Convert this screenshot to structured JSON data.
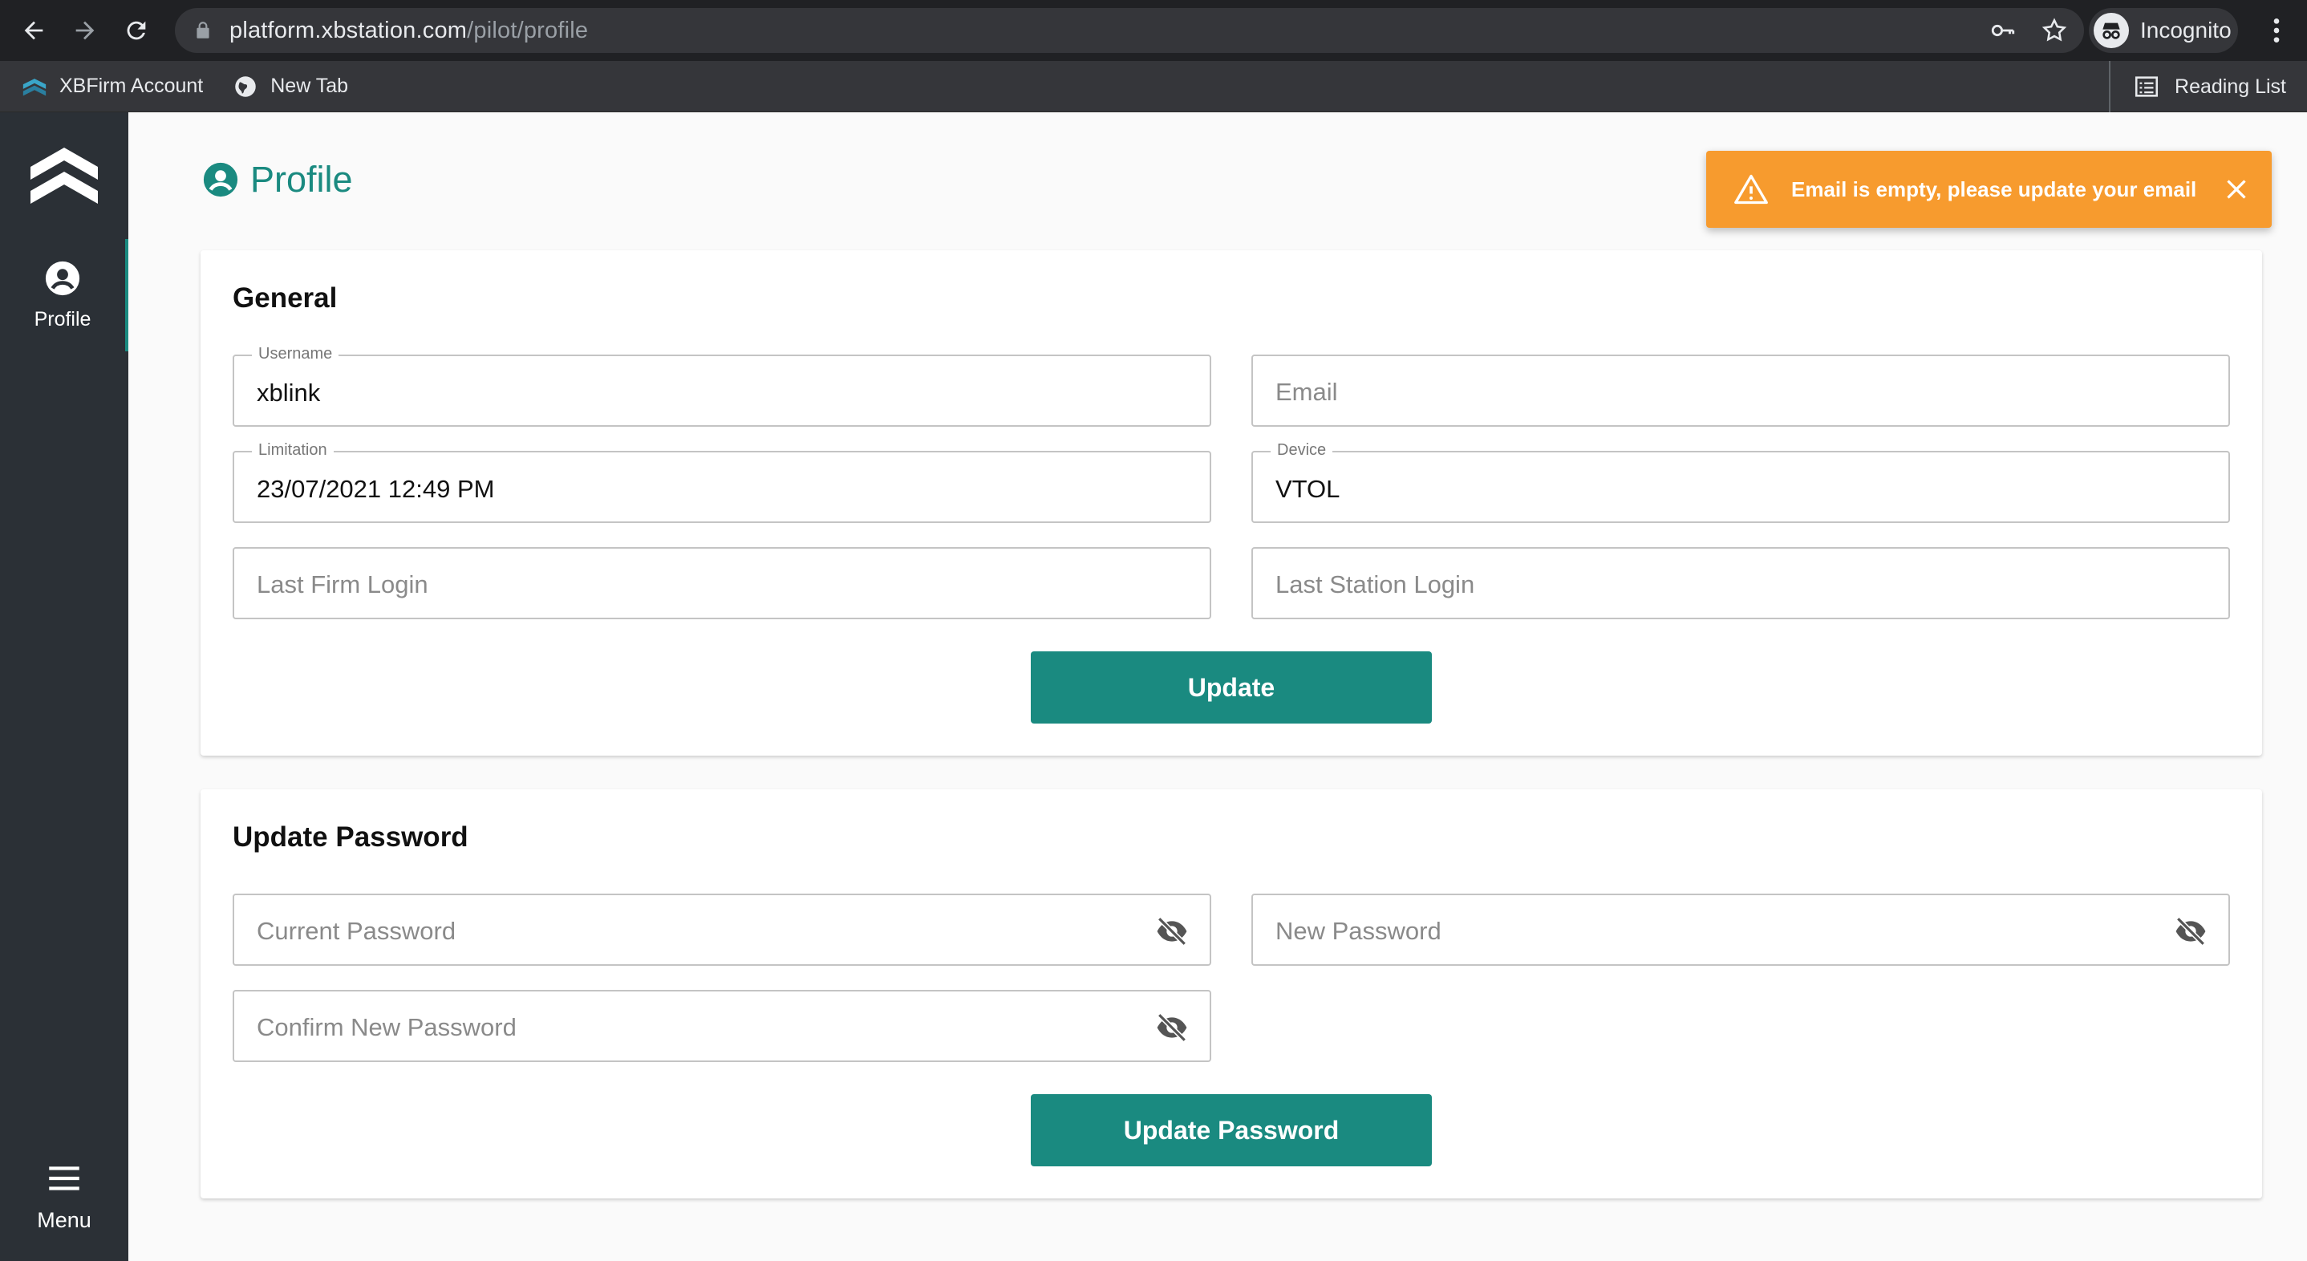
{
  "browser": {
    "url_host": "platform.xbstation.com",
    "url_path": "/pilot/profile",
    "incognito_label": "Incognito",
    "bookmarks": [
      "XBFirm Account",
      "New Tab"
    ],
    "reading_list_label": "Reading List"
  },
  "sidebar": {
    "items": [
      {
        "label": "Profile",
        "icon": "account-circle-icon"
      }
    ],
    "menu_label": "Menu"
  },
  "page": {
    "title": "Profile"
  },
  "toast": {
    "message": "Email is empty, please update your email",
    "color": "#f79b2e"
  },
  "general": {
    "heading": "General",
    "username": {
      "label": "Username",
      "value": "xblink"
    },
    "email": {
      "placeholder": "Email"
    },
    "limitation": {
      "label": "Limitation",
      "value": "23/07/2021 12:49 PM"
    },
    "device": {
      "label": "Device",
      "value": "VTOL"
    },
    "last_firm_login": {
      "placeholder": "Last Firm Login"
    },
    "last_station_login": {
      "placeholder": "Last Station Login"
    },
    "update_label": "Update"
  },
  "password": {
    "heading": "Update Password",
    "current": {
      "placeholder": "Current Password"
    },
    "new": {
      "placeholder": "New Password"
    },
    "confirm": {
      "placeholder": "Confirm New Password"
    },
    "update_label": "Update Password"
  },
  "colors": {
    "accent": "#1a8a80",
    "sidebar": "#2b3036",
    "warning": "#f79b2e"
  }
}
